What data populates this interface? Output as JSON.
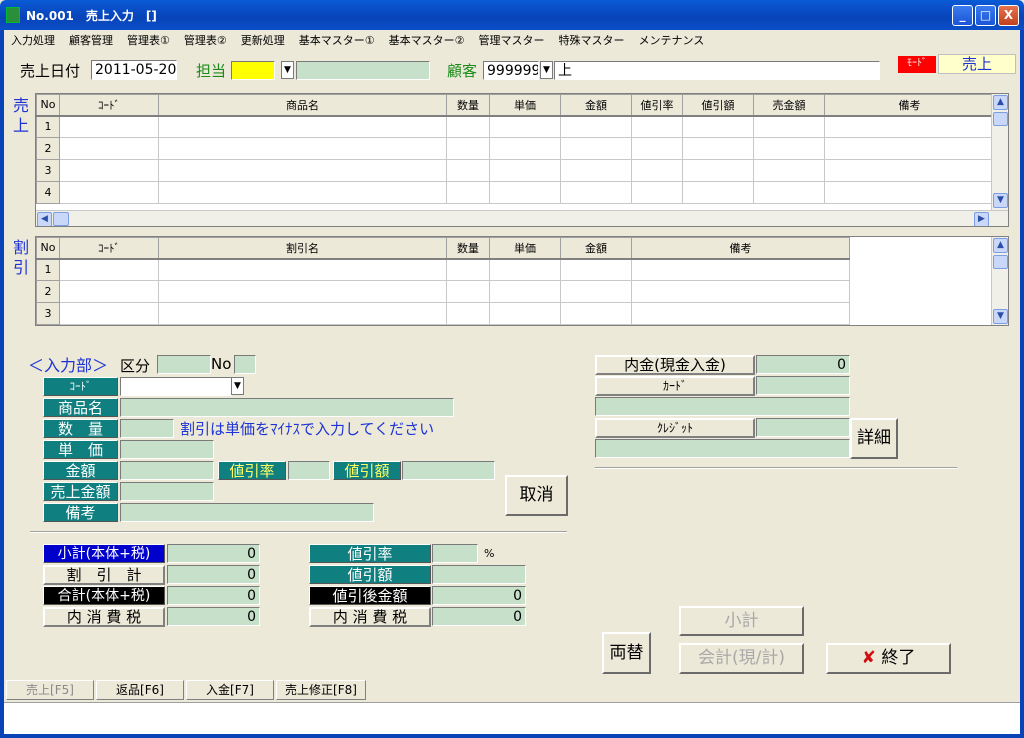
{
  "window": {
    "title": "No.001　売上入力　[]"
  },
  "titlebar_buttons": {
    "minimize": "_",
    "maximize": "□",
    "close": "X"
  },
  "menu": [
    "入力処理",
    "顧客管理",
    "管理表①",
    "管理表②",
    "更新処理",
    "基本マスター①",
    "基本マスター②",
    "管理マスター",
    "特殊マスター",
    "メンテナンス"
  ],
  "header": {
    "date_label": "売上日付",
    "date_value": "2011-05-20",
    "staff_label": "担当",
    "staff_code": "",
    "staff_name": "",
    "customer_label": "顧客",
    "customer_code": "999999",
    "customer_name": "上",
    "mode_label": "ﾓｰﾄﾞ",
    "mode_value": "売上"
  },
  "sales_grid": {
    "side_label": [
      "売",
      "上"
    ],
    "columns": [
      "No",
      "ｺｰﾄﾞ",
      "商品名",
      "数量",
      "単価",
      "金額",
      "値引率",
      "値引額",
      "売金額",
      "備考"
    ],
    "rows": [
      "1",
      "2",
      "3",
      "4"
    ]
  },
  "discount_grid": {
    "side_label": [
      "割",
      "引"
    ],
    "columns": [
      "No",
      "ｺｰﾄﾞ",
      "割引名",
      "数量",
      "単価",
      "金額",
      "備考"
    ],
    "rows": [
      "1",
      "2",
      "3"
    ]
  },
  "input": {
    "section_title": "＜入力部＞",
    "kubun_label": "区分",
    "no_label": "No",
    "code_label": "ｺｰﾄﾞ",
    "name_label": "商品名",
    "qty_label": "数　量",
    "hint": "割引は単価をﾏｲﾅｽで入力してください",
    "price_label": "単　価",
    "amount_label": "金額",
    "rate_label": "値引率",
    "disc_label": "値引額",
    "sales_amount_label": "売上金額",
    "note_label": "備考",
    "cancel_button": "取消"
  },
  "payment": {
    "cash_label": "内金(現金入金)",
    "cash_value": "0",
    "card_label": "ｶｰﾄﾞ",
    "credit_label": "ｸﾚｼﾞｯﾄ",
    "detail_button": "詳細"
  },
  "totals": {
    "subtotal_label": "小計(本体+税)",
    "subtotal_value": "0",
    "discount_total_label": "割　引　計",
    "discount_total_value": "0",
    "total_label": "合計(本体+税)",
    "total_value": "0",
    "tax_label": "内 消 費 税",
    "tax_value": "0",
    "rate_label": "値引率",
    "rate_unit": "%",
    "disc_amount_label": "値引額",
    "after_disc_label": "値引後金額",
    "after_disc_value": "0",
    "tax2_label": "内 消 費 税",
    "tax2_value": "0"
  },
  "actions": {
    "exchange": "両替",
    "subtotal": "小計",
    "checkout": "会計(現/計)",
    "exit": "終了",
    "exit_icon": "✘"
  },
  "fkeys": [
    "売上[F5]",
    "返品[F6]",
    "入金[F7]",
    "売上修正[F8]"
  ],
  "colors": {
    "accent_teal": "#0f7f7f",
    "field_green": "#c6e0c9",
    "title_blue": "#0843b8",
    "mode_red": "#ff0000"
  }
}
